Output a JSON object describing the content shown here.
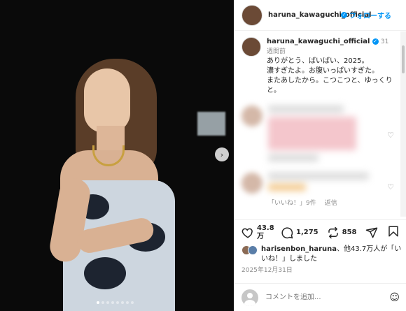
{
  "header": {
    "username": "haruna_kawaguchi_official",
    "follow_label": "フォローする",
    "more_label": "•••"
  },
  "media": {
    "next_icon": "chevron-right-icon",
    "carousel_count": 8,
    "carousel_active_index": 0
  },
  "caption": {
    "username": "haruna_kawaguchi_official",
    "ago": "31週間前",
    "text": "ありがとう、ばいばい、2025。\n濃すぎたよ。お腹いっぱいすぎた。\nまたあしたから。こつこつと、ゆっくりと。"
  },
  "comment_meta": {
    "likes": "「いいね！」9件",
    "reply": "返信"
  },
  "actions": {
    "likes_count": "43.8万",
    "comments_count": "1,275",
    "reposts_count": "858"
  },
  "liked_by": {
    "user": "harisenbon_haruna",
    "rest": "、他43.7万人が「いいね！」しました"
  },
  "date": "2025年12月31日",
  "comment_input": {
    "placeholder": "コメントを追加..."
  },
  "colors": {
    "accent": "#0095f6",
    "muted": "#8e8e8e"
  }
}
